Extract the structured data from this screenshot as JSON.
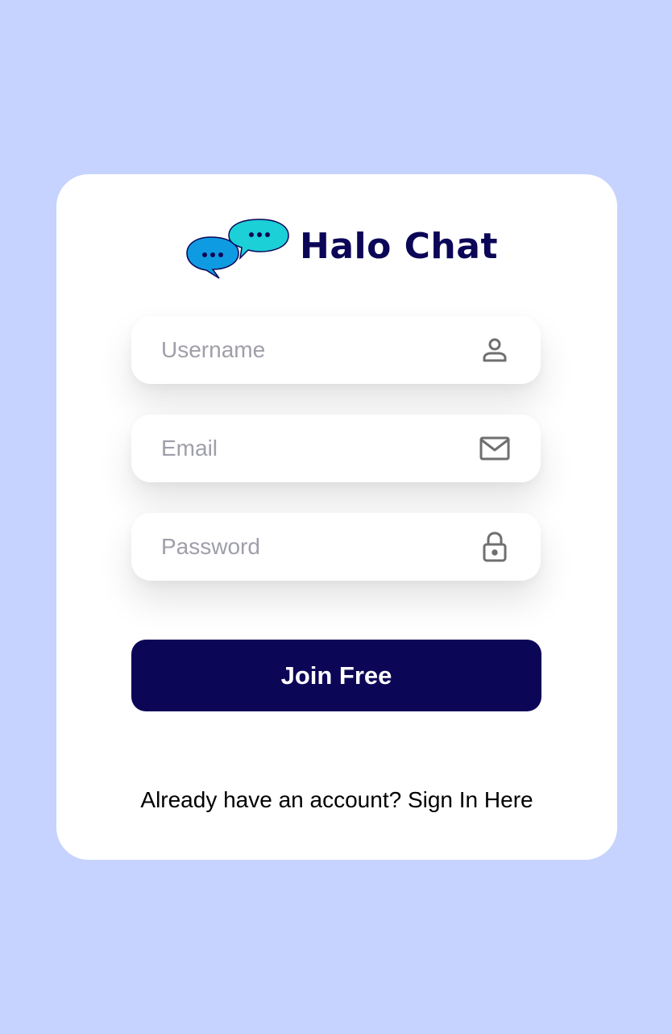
{
  "brand": {
    "name": "Halo Chat",
    "logo_icon": "chat-bubbles-icon",
    "colors": {
      "text": "#0c0657",
      "bubble_back": "#0f9be2",
      "bubble_front": "#1bd0d6",
      "dots": "#0c0657"
    }
  },
  "form": {
    "username": {
      "placeholder": "Username",
      "value": "",
      "icon": "user-icon"
    },
    "email": {
      "placeholder": "Email",
      "value": "",
      "icon": "envelope-icon"
    },
    "password": {
      "placeholder": "Password",
      "value": "",
      "icon": "lock-icon"
    },
    "submit_label": "Join Free"
  },
  "footer": {
    "prompt": "Already have an account?",
    "link_label": "Sign In Here"
  },
  "colors": {
    "page_background": "#c6d3ff",
    "card_background": "#ffffff",
    "button_background": "#0c0657",
    "button_text": "#ffffff",
    "placeholder": "#9e9fa8",
    "icon": "#6f6f72"
  }
}
